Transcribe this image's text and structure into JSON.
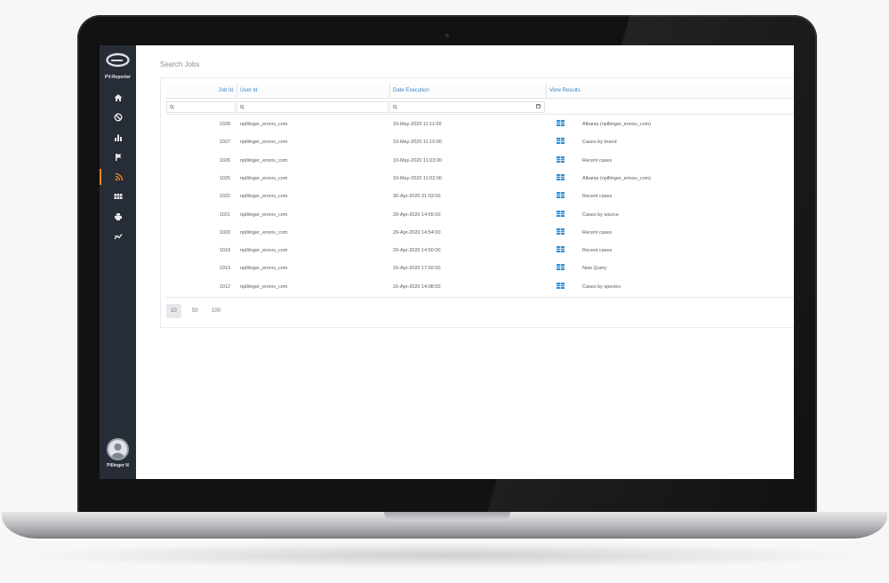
{
  "app": {
    "brand": "PV-Reporter",
    "user_name": "Pillinger N"
  },
  "sidebar": {
    "items": [
      {
        "icon": "home-icon"
      },
      {
        "icon": "block-icon"
      },
      {
        "icon": "bar-chart-icon"
      },
      {
        "icon": "flag-icon"
      },
      {
        "icon": "rss-icon",
        "active": true
      },
      {
        "icon": "grid-icon"
      },
      {
        "icon": "printer-icon"
      },
      {
        "icon": "trend-icon"
      }
    ]
  },
  "page": {
    "title": "Search Jobs"
  },
  "table": {
    "columns": [
      "Job Id",
      "User Id",
      "Date Execution",
      "View Results"
    ],
    "rows": [
      {
        "job_id": "1028",
        "user_id": "npillinger_ennov_com",
        "date": "10-May-2020 11:11:00",
        "result": "Albania (npillinger_ennov_com)"
      },
      {
        "job_id": "1027",
        "user_id": "npillinger_ennov_com",
        "date": "10-May-2020 11:10:00",
        "result": "Cases by brand"
      },
      {
        "job_id": "1026",
        "user_id": "npillinger_ennov_com",
        "date": "10-May-2020 11:03:00",
        "result": "Recent cases"
      },
      {
        "job_id": "1025",
        "user_id": "npillinger_ennov_com",
        "date": "10-May-2020 11:02:00",
        "result": "Albania (npillinger_ennov_com)"
      },
      {
        "job_id": "1022",
        "user_id": "npillinger_ennov_com",
        "date": "30-Apr-2020 21:03:00",
        "result": "Recent cases"
      },
      {
        "job_id": "1021",
        "user_id": "npillinger_ennov_com",
        "date": "29-Apr-2020 14:55:00",
        "result": "Cases by source"
      },
      {
        "job_id": "1020",
        "user_id": "npillinger_ennov_com",
        "date": "29-Apr-2020 14:54:00",
        "result": "Recent cases"
      },
      {
        "job_id": "1019",
        "user_id": "npillinger_ennov_com",
        "date": "29-Apr-2020 14:50:00",
        "result": "Recent cases"
      },
      {
        "job_id": "1013",
        "user_id": "npillinger_ennov_com",
        "date": "16-Apr-2020 17:02:00",
        "result": "New Query"
      },
      {
        "job_id": "1012",
        "user_id": "npillinger_ennov_com",
        "date": "16-Apr-2020 14:08:00",
        "result": "Cases by species"
      }
    ]
  },
  "pager": {
    "sizes": [
      "10",
      "50",
      "100"
    ],
    "selected": "10"
  },
  "colors": {
    "sidebar_bg": "#272d36",
    "accent": "#f08a24",
    "link": "#3a86c8",
    "result_icon": "#2f8fd8"
  }
}
